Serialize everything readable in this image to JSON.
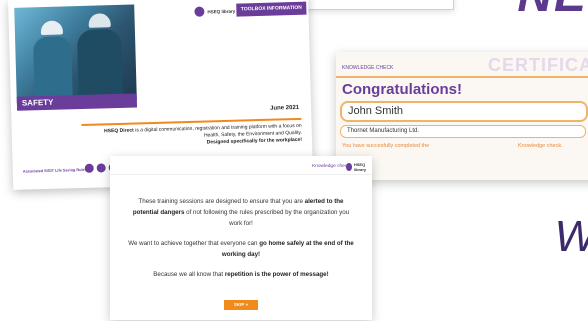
{
  "background": {
    "letters": "NE",
    "cursive": "W"
  },
  "toolbox": {
    "photo_label": "SAFETY",
    "logo_text": "HSEQ library",
    "banner": "TOOLBOX INFORMATION",
    "date": "June 2021",
    "desc_lead": "HSEQ Direct",
    "desc_rest": " is a digital communication, registration and training platform with a focus on Health, Safety, the Environment and Quality.",
    "desc_tail": "Designed specifically for the workplace!",
    "footer": "Associated SIGIT Life Saving Rules",
    "accent": "#6a3d9a",
    "rule_color": "#f08a1c"
  },
  "certificate": {
    "small_label": "KNOWLEDGE CHECK",
    "title": "CERTIFICATE",
    "congrats": "Congratulations!",
    "name": "John Smith",
    "company": "Thornet Manufacturing Ltd.",
    "completed_text": "You have succesfully completed the",
    "completed_item": "Knowledge check."
  },
  "training": {
    "header_kc": "Knowledge check",
    "logo_text": "HSEQ library",
    "p1_a": "These training sessions are designed to ensure that you are ",
    "p1_b": "alerted to the potential dangers",
    "p1_c": " of not following the rules prescribed by the organization you work for!",
    "p2_a": "We want to achieve together that everyone can ",
    "p2_b": "go home safely at the end of the working day!",
    "p3_a": "Because we all know that ",
    "p3_b": "repetition is the power of message!",
    "skip": "SKIP »"
  }
}
